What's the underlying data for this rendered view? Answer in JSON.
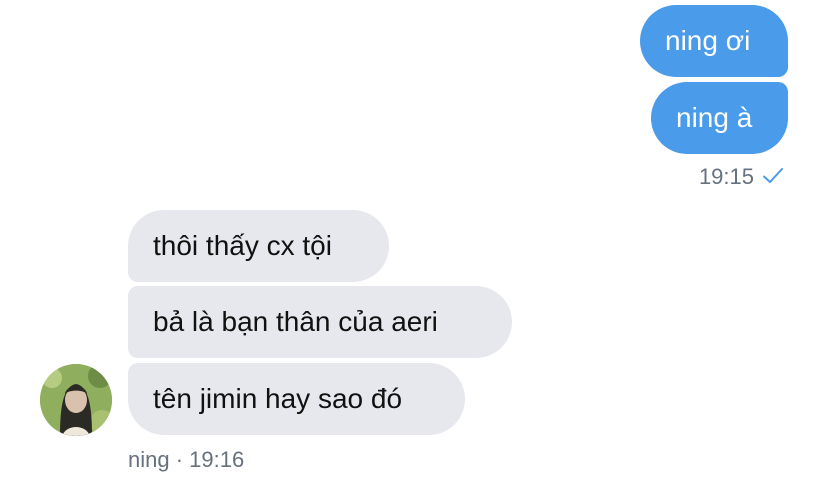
{
  "outgoing": {
    "messages": [
      {
        "text": "ning ơi"
      },
      {
        "text": "ning à"
      }
    ],
    "time": "19:15",
    "status_icon": "check-icon"
  },
  "incoming": {
    "messages": [
      {
        "text": "thôi thấy cx tội"
      },
      {
        "text": "bả là bạn thân của aeri"
      },
      {
        "text": "tên jimin hay sao đó"
      }
    ],
    "sender_meta": "ning · 19:16",
    "avatar_icon": "avatar"
  },
  "colors": {
    "outgoing_bubble": "#4a9bea",
    "incoming_bubble": "#e6e8ee",
    "meta_text": "#66717f",
    "check": "#4a9bea"
  }
}
